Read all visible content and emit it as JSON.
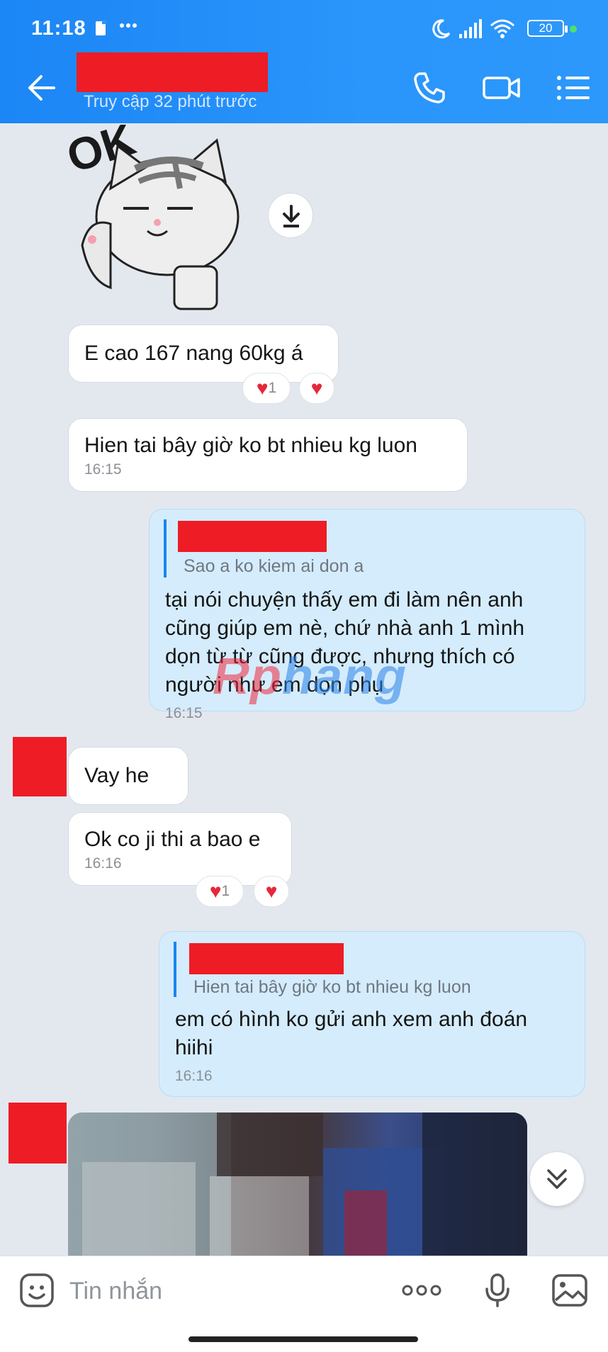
{
  "status_bar": {
    "time": "11:18",
    "battery": "20"
  },
  "header": {
    "subtitle": "Truy cập 32 phút trước"
  },
  "messages": {
    "sticker_text": "OK",
    "m1": {
      "text": "E cao 167 nang 60kg á",
      "react_count": "1"
    },
    "m2": {
      "text": "Hien tai bây giờ ko bt nhieu kg luon",
      "time": "16:15"
    },
    "m3": {
      "quote": "Sao a ko kiem ai don a",
      "lines": [
        "tại nói chuyện thấy em đi làm nên anh",
        "cũng giúp em nè, chứ nhà anh 1 mình",
        "dọn từ từ cũng được, nhưng thích có",
        "người như em dọn phụ"
      ],
      "time": "16:15"
    },
    "m4": {
      "text": "Vay he"
    },
    "m5": {
      "text": "Ok co ji thi a bao e",
      "time": "16:16",
      "react_count": "1"
    },
    "m6": {
      "quote": "Hien tai bây giờ ko bt nhieu kg luon",
      "lines": [
        "em có hình ko gửi anh xem anh đoán",
        "hiihi"
      ],
      "time": "16:16"
    }
  },
  "watermark": {
    "part1": "Rp",
    "part2": "hang"
  },
  "input": {
    "placeholder": "Tin nhắn"
  },
  "colors": {
    "header": "#2a95fb",
    "outgoing_bubble": "#d4ecfc",
    "reaction_heart": "#e5283a",
    "redaction": "#ee1c25"
  }
}
